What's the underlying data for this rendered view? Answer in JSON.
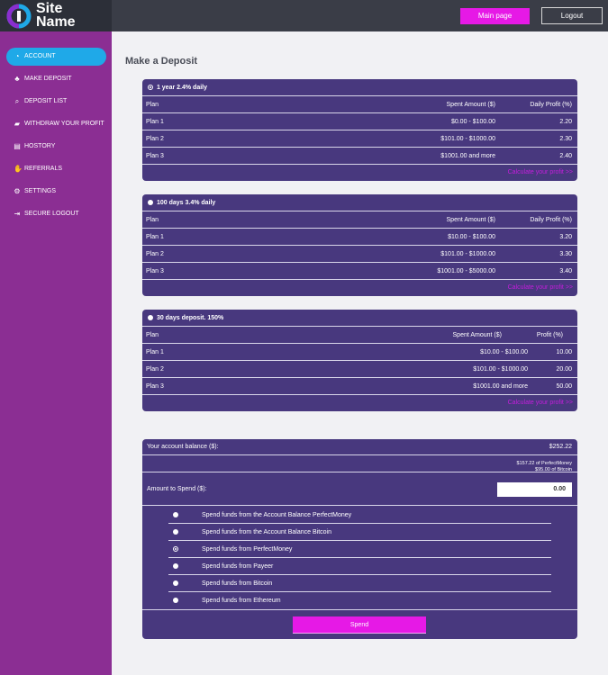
{
  "header": {
    "logo_line1": "Site",
    "logo_line2": "Name",
    "main_page_label": "Main page",
    "logout_label": "Logout",
    "brand_accent": "#e619e6"
  },
  "sidebar": {
    "items": [
      {
        "label": "ACCOUNT",
        "icon": "dashboard-icon",
        "active": true
      },
      {
        "label": "MAKE DEPOSIT",
        "icon": "piggy-bank-icon"
      },
      {
        "label": "DEPOSIT LIST",
        "icon": "search-icon"
      },
      {
        "label": "WITHDRAW YOUR PROFIT",
        "icon": "tag-icon"
      },
      {
        "label": "HOSTORY",
        "icon": "list-icon"
      },
      {
        "label": "REFERRALS",
        "icon": "handshake-icon"
      },
      {
        "label": "SETTINGS",
        "icon": "gears-icon"
      },
      {
        "label": "SECURE LOGOUT",
        "icon": "sign-out-icon"
      }
    ]
  },
  "page": {
    "title": "Make a Deposit"
  },
  "plans": [
    {
      "name": "1 year 2.4% daily",
      "headers": [
        "Plan",
        "Spent Amount ($)",
        "Daily Profit (%)"
      ],
      "rows": [
        [
          "Plan 1",
          "$0.00 - $100.00",
          "2.20"
        ],
        [
          "Plan 2",
          "$101.00 - $1000.00",
          "2.30"
        ],
        [
          "Plan 3",
          "$1001.00 and more",
          "2.40"
        ]
      ],
      "calc_label": "Calculate your profit >>"
    },
    {
      "name": "100 days 3.4% daily",
      "headers": [
        "Plan",
        "Spent Amount ($)",
        "Daily Profit (%)"
      ],
      "rows": [
        [
          "Plan 1",
          "$10.00 - $100.00",
          "3.20"
        ],
        [
          "Plan 2",
          "$101.00 - $1000.00",
          "3.30"
        ],
        [
          "Plan 3",
          "$1001.00 - $5000.00",
          "3.40"
        ]
      ],
      "calc_label": "Calculate your profit >>"
    },
    {
      "name": "30 days deposit. 150%",
      "headers": [
        "Plan",
        "Spent Amount ($)",
        "Profit  (%)"
      ],
      "rows": [
        [
          "Plan 1",
          "$10.00 - $100.00",
          "10.00"
        ],
        [
          "Plan 2",
          "$101.00 - $1000.00",
          "20.00"
        ],
        [
          "Plan 3",
          "$1001.00 and more",
          "50.00"
        ]
      ],
      "calc_label": "Calculate your profit >>"
    }
  ],
  "balance": {
    "label": "Your account balance ($):",
    "value": "$252.22",
    "detail_line1": "$157.22 of PerfectMoney",
    "detail_line2": "$95.00 of Bitcoin",
    "amount_label": "Amount to Spend ($):",
    "amount_value": "0.00",
    "options": [
      "Spend funds from the Account Balance PerfectMoney",
      "Spend funds from the Account Balance Bitcoin",
      "Spend funds from PerfectMoney",
      "Spend funds from Payeer",
      "Spend funds from Bitcoin",
      "Spend funds from Ethereum"
    ],
    "spend_label": "Spend"
  }
}
